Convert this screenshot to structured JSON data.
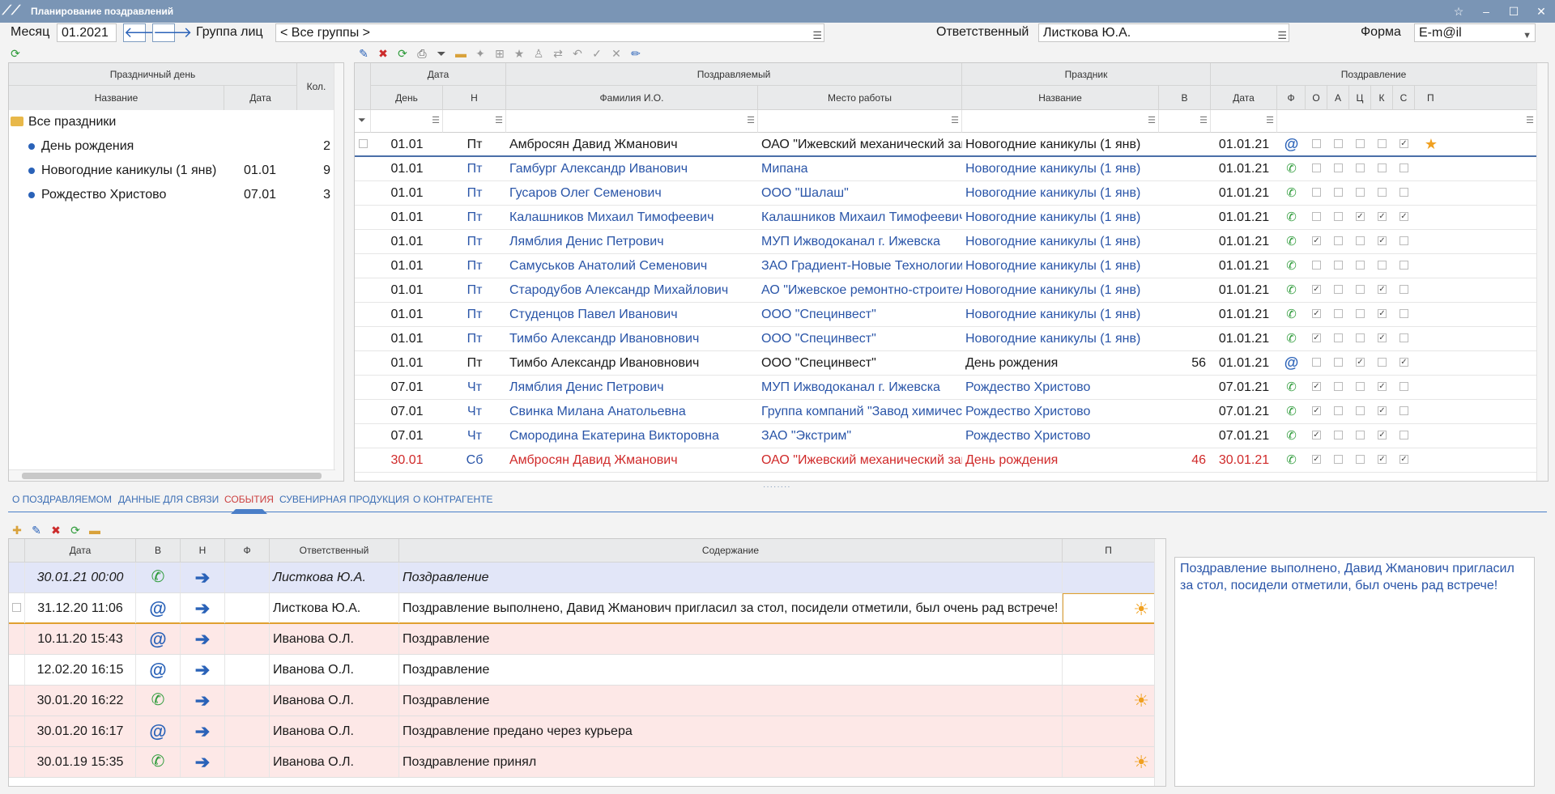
{
  "window": {
    "title": "Планирование поздравлений",
    "controls": [
      "☆",
      "–",
      "☐",
      "✕"
    ]
  },
  "topbar": {
    "month_label": "Месяц",
    "month_value": "01.2021",
    "group_label": "Группа лиц",
    "group_value": "< Все группы >",
    "responsible_label": "Ответственный",
    "responsible_value": "Листкова Ю.А.",
    "form_label": "Форма",
    "form_value": "E-m@il"
  },
  "holidays": {
    "header_group": "Праздничный день",
    "col_name": "Название",
    "col_date": "Дата",
    "col_count": "Кол.",
    "root": "Все праздники",
    "items": [
      {
        "name": "День рождения",
        "date": "",
        "count": "2"
      },
      {
        "name": "Новогодние каникулы (1 янв)",
        "date": "01.01",
        "count": "9"
      },
      {
        "name": "Рождество Христово",
        "date": "07.01",
        "count": "3"
      }
    ]
  },
  "grid": {
    "groups": {
      "date": "Дата",
      "person": "Поздравляемый",
      "holiday": "Праздник",
      "greeting": "Поздравление"
    },
    "cols": {
      "day": "День",
      "n": "Н",
      "fio": "Фамилия И.О.",
      "work": "Место работы",
      "hname": "Название",
      "v": "В",
      "gdate": "Дата",
      "f": "Ф",
      "o": "О",
      "a": "А",
      "ts": "Ц",
      "k": "К",
      "s": "С",
      "p": "П"
    },
    "rows": [
      {
        "day": "01.01",
        "n": "Пт",
        "fio": "Амбросян Давид Жманович",
        "work": "ОАО \"Ижевский механический завод\"",
        "hname": "Новогодние каникулы (1 янв)",
        "v": "",
        "gdate": "01.01.21",
        "f": "@",
        "flags": [
          0,
          0,
          0,
          0,
          1
        ],
        "star": true,
        "color": "black"
      },
      {
        "day": "01.01",
        "n": "Пт",
        "fio": "Гамбург Александр Иванович",
        "work": "Мипана",
        "hname": "Новогодние каникулы (1 янв)",
        "v": "",
        "gdate": "01.01.21",
        "f": "phone",
        "flags": [
          0,
          0,
          0,
          0,
          0
        ],
        "color": "blue"
      },
      {
        "day": "01.01",
        "n": "Пт",
        "fio": "Гусаров Олег Семенович",
        "work": "ООО \"Шалаш\"",
        "hname": "Новогодние каникулы (1 янв)",
        "v": "",
        "gdate": "01.01.21",
        "f": "phone",
        "flags": [
          0,
          0,
          0,
          0,
          0
        ],
        "color": "blue"
      },
      {
        "day": "01.01",
        "n": "Пт",
        "fio": "Калашников Михаил Тимофеевич",
        "work": "Калашников Михаил Тимофеевич",
        "hname": "Новогодние каникулы (1 янв)",
        "v": "",
        "gdate": "01.01.21",
        "f": "phone",
        "flags": [
          0,
          0,
          1,
          1,
          1
        ],
        "color": "blue"
      },
      {
        "day": "01.01",
        "n": "Пт",
        "fio": "Лямблия Денис Петрович",
        "work": "МУП Ижводоканал г. Ижевска",
        "hname": "Новогодние каникулы (1 янв)",
        "v": "",
        "gdate": "01.01.21",
        "f": "phone",
        "flags": [
          1,
          0,
          0,
          1,
          0
        ],
        "color": "blue"
      },
      {
        "day": "01.01",
        "n": "Пт",
        "fio": "Самуськов Анатолий Семенович",
        "work": "ЗАО Градиент-Новые Технологии",
        "hname": "Новогодние каникулы (1 янв)",
        "v": "",
        "gdate": "01.01.21",
        "f": "phone",
        "flags": [
          0,
          0,
          0,
          0,
          0
        ],
        "color": "blue"
      },
      {
        "day": "01.01",
        "n": "Пт",
        "fio": "Стародубов Александр Михайлович",
        "work": "АО \"Ижевское ремонтно-строительное управлени",
        "hname": "Новогодние каникулы (1 янв)",
        "v": "",
        "gdate": "01.01.21",
        "f": "phone",
        "flags": [
          1,
          0,
          0,
          1,
          0
        ],
        "color": "blue"
      },
      {
        "day": "01.01",
        "n": "Пт",
        "fio": "Студенцов Павел Иванович",
        "work": "ООО \"Специнвест\"",
        "hname": "Новогодние каникулы (1 янв)",
        "v": "",
        "gdate": "01.01.21",
        "f": "phone",
        "flags": [
          1,
          0,
          0,
          1,
          0
        ],
        "color": "blue"
      },
      {
        "day": "01.01",
        "n": "Пт",
        "fio": "Тимбо Александр Ивановнович",
        "work": "ООО \"Специнвест\"",
        "hname": "Новогодние каникулы (1 янв)",
        "v": "",
        "gdate": "01.01.21",
        "f": "phone",
        "flags": [
          1,
          0,
          0,
          1,
          0
        ],
        "color": "blue"
      },
      {
        "day": "01.01",
        "n": "Пт",
        "fio": "Тимбо Александр Ивановнович",
        "work": "ООО \"Специнвест\"",
        "hname": "День рождения",
        "v": "56",
        "gdate": "01.01.21",
        "f": "@",
        "flags": [
          0,
          0,
          1,
          0,
          1
        ],
        "color": "black"
      },
      {
        "day": "07.01",
        "n": "Чт",
        "fio": "Лямблия Денис Петрович",
        "work": "МУП Ижводоканал г. Ижевска",
        "hname": "Рождество Христово",
        "v": "",
        "gdate": "07.01.21",
        "f": "phone",
        "flags": [
          1,
          0,
          0,
          1,
          0
        ],
        "color": "blue"
      },
      {
        "day": "07.01",
        "n": "Чт",
        "fio": "Свинка Милана Анатольевна",
        "work": "Группа компаний \"Завод химических реагентов\"",
        "hname": "Рождество Христово",
        "v": "",
        "gdate": "07.01.21",
        "f": "phone",
        "flags": [
          1,
          0,
          0,
          1,
          0
        ],
        "color": "blue"
      },
      {
        "day": "07.01",
        "n": "Чт",
        "fio": "Смородина Екатерина Викторовна",
        "work": "ЗАО \"Экстрим\"",
        "hname": "Рождество Христово",
        "v": "",
        "gdate": "07.01.21",
        "f": "phone",
        "flags": [
          1,
          0,
          0,
          1,
          0
        ],
        "color": "blue"
      },
      {
        "day": "30.01",
        "n": "Сб",
        "fio": "Амбросян Давид Жманович",
        "work": "ОАО \"Ижевский механический завод\"",
        "hname": "День рождения",
        "v": "46",
        "gdate": "30.01.21",
        "f": "phone",
        "flags": [
          1,
          0,
          0,
          1,
          1
        ],
        "color": "red"
      }
    ]
  },
  "tabs": [
    "О ПОЗДРАВЛЯЕМОМ",
    "ДАННЫЕ ДЛЯ СВЯЗИ",
    "СОБЫТИЯ",
    "СУВЕНИРНАЯ ПРОДУКЦИЯ",
    "О КОНТРАГЕНТЕ"
  ],
  "active_tab": "СОБЫТИЯ",
  "events": {
    "cols": {
      "date": "Дата",
      "v": "В",
      "n": "Н",
      "f": "Ф",
      "resp": "Ответственный",
      "content": "Содержание",
      "p": "П"
    },
    "rows": [
      {
        "date": "30.01.21 00:00",
        "v": "phone",
        "resp": "Листкова Ю.А.",
        "content": "Поздравление",
        "p": "",
        "style": "lav"
      },
      {
        "date": "31.12.20 11:06",
        "v": "@",
        "resp": "Листкова Ю.А.",
        "content": "Поздравление выполнено, Давид Жманович пригласил за стол, посидели отметили, был очень рад встрече!",
        "p": "sun",
        "style": "sel"
      },
      {
        "date": "10.11.20 15:43",
        "v": "@",
        "resp": "Иванова О.Л.",
        "content": "Поздравление",
        "p": "",
        "style": "pink"
      },
      {
        "date": "12.02.20 16:15",
        "v": "@",
        "resp": "Иванова О.Л.",
        "content": "Поздравление",
        "p": "",
        "style": "white"
      },
      {
        "date": "30.01.20 16:22",
        "v": "phone",
        "resp": "Иванова О.Л.",
        "content": "Поздравление",
        "p": "sun",
        "style": "pink"
      },
      {
        "date": "30.01.20 16:17",
        "v": "@",
        "resp": "Иванова О.Л.",
        "content": "Поздравление предано через курьера",
        "p": "",
        "style": "pink"
      },
      {
        "date": "30.01.19 15:35",
        "v": "phone",
        "resp": "Иванова О.Л.",
        "content": "Поздравление принял",
        "p": "sun",
        "style": "pink"
      }
    ]
  },
  "memo": "Поздравление выполнено, Давид Жманович пригласил за стол, посидели отметили, был очень рад встрече!"
}
